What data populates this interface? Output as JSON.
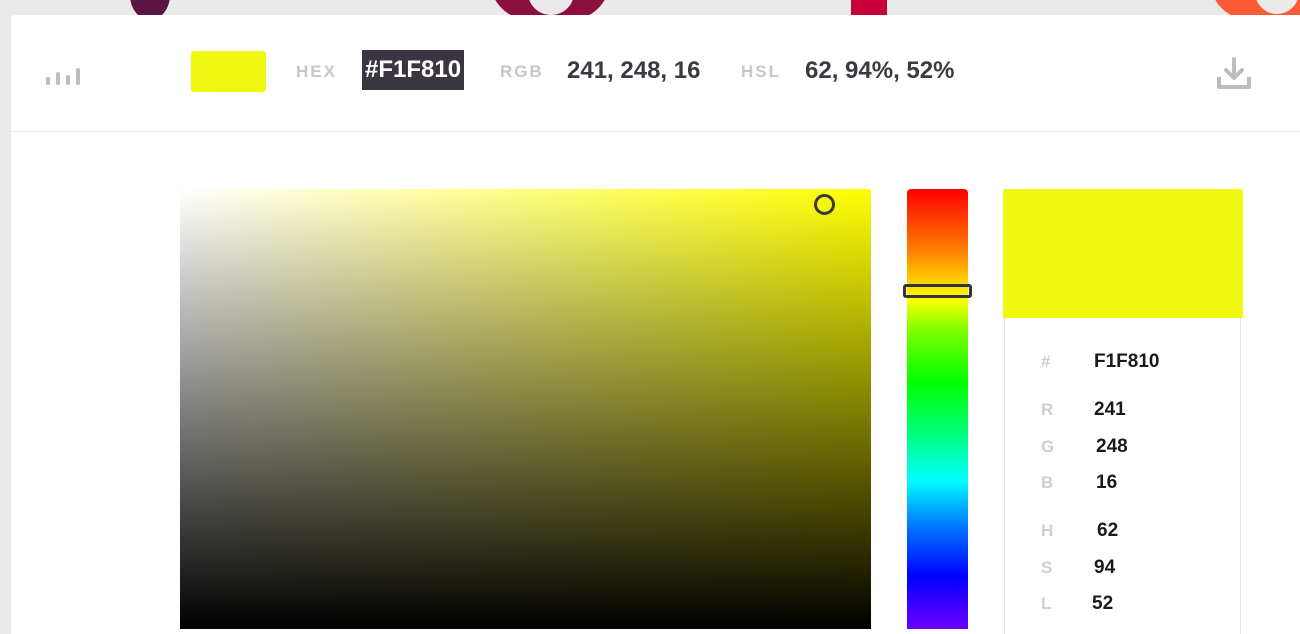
{
  "colors": {
    "current": "#F1F810",
    "hue_pure": "#FFFF00"
  },
  "toolbar": {
    "stats_icon": "bars-chart-icon",
    "hex_label": "HEX",
    "hex_value": "#F1F810",
    "rgb_label": "RGB",
    "rgb_value": "241, 248, 16",
    "hsl_label": "HSL",
    "hsl_value": "62, 94%, 52%",
    "download_icon": "download-icon"
  },
  "picker": {
    "saturation": 0.94,
    "brightness": 0.97,
    "hue_degrees": 62
  },
  "info": {
    "hash_label": "#",
    "hash_value": "F1F810",
    "r_label": "R",
    "r_value": "241",
    "g_label": "G",
    "g_value": "248",
    "b_label": "B",
    "b_value": "16",
    "h_label": "H",
    "h_value": "62",
    "s_label": "S",
    "s_value": "94",
    "l_label": "L",
    "l_value": "52"
  }
}
